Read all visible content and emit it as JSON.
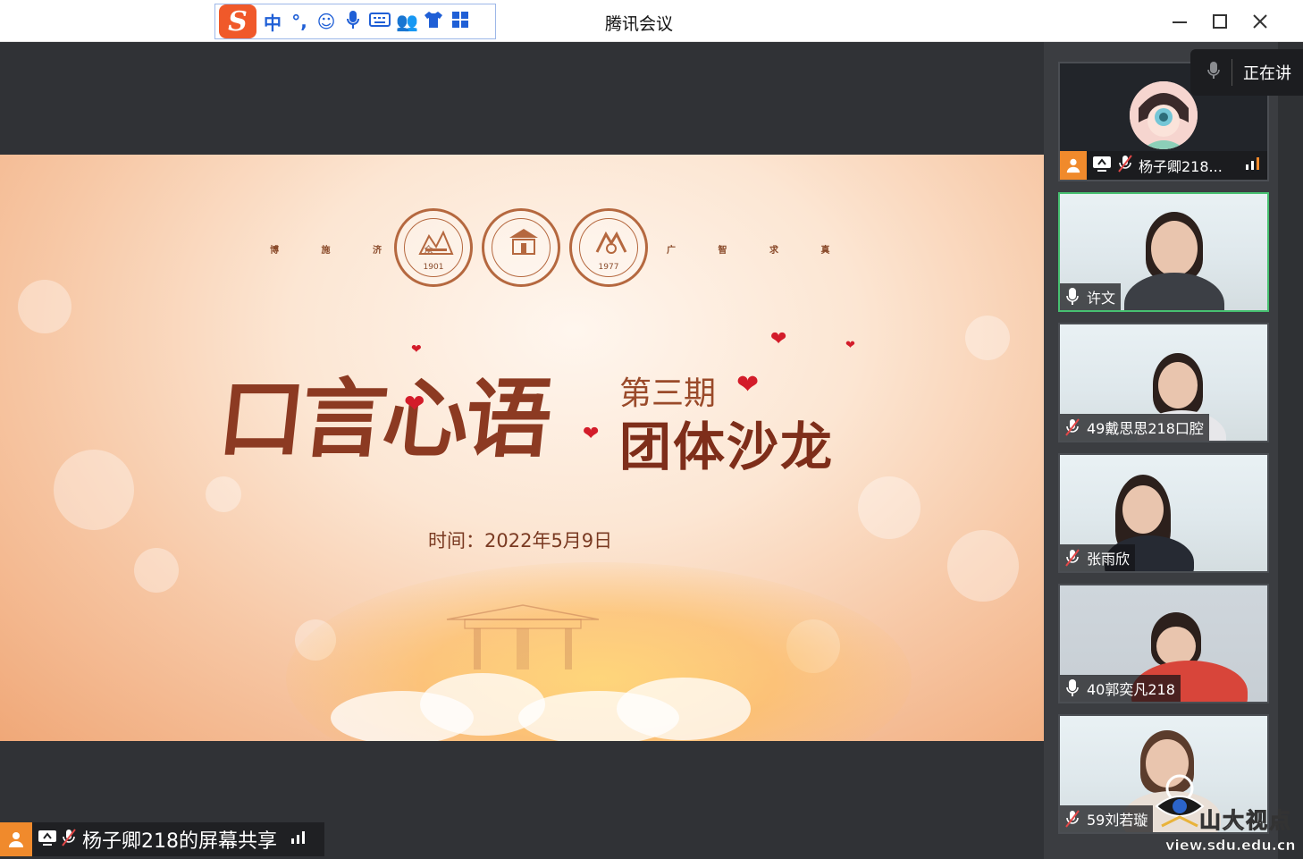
{
  "window": {
    "title": "腾讯会议"
  },
  "ime_toolbar": {
    "mode_label": "中",
    "punct_label": "°,"
  },
  "slide": {
    "motto_left": "博 施 济 众",
    "motto_right": "广 智 求 真",
    "seal1_year": "1901",
    "seal3_year": "1977",
    "calligraphy_title": "口言心语",
    "issue": "第三期",
    "subtitle": "团体沙龙",
    "date_text": "时间：2022年5月9日"
  },
  "share_bar": {
    "label": "杨子卿218的屏幕共享"
  },
  "speaking": {
    "label": "正在讲"
  },
  "participants": [
    {
      "name": "杨子卿218...",
      "mic": "muted",
      "type": "avatar"
    },
    {
      "name": "许文",
      "mic": "on",
      "type": "camera",
      "active": true
    },
    {
      "name": "49戴思思218口腔",
      "mic": "muted",
      "type": "camera"
    },
    {
      "name": "张雨欣",
      "mic": "muted",
      "type": "camera"
    },
    {
      "name": "40郭奕凡218",
      "mic": "on",
      "type": "camera"
    },
    {
      "name": "59刘若璇",
      "mic": "muted",
      "type": "camera"
    }
  ],
  "watermark": {
    "name": "山大视点",
    "url": "view.sdu.edu.cn"
  },
  "colors": {
    "accent": "#f08a2c",
    "active_border": "#47c071",
    "title_red": "#7e2e1a"
  }
}
